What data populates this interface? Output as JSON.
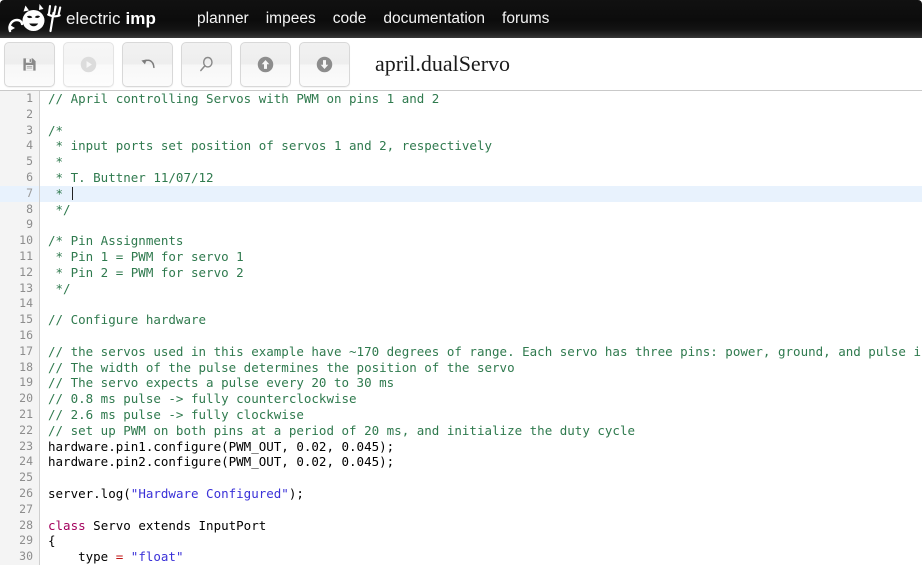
{
  "header": {
    "brand_prefix": "electric ",
    "brand_bold": "imp",
    "logo_icon": "imp-devil-logo-icon",
    "nav": [
      {
        "label": "planner",
        "name": "nav-planner"
      },
      {
        "label": "impees",
        "name": "nav-impees"
      },
      {
        "label": "code",
        "name": "nav-code"
      },
      {
        "label": "documentation",
        "name": "nav-documentation"
      },
      {
        "label": "forums",
        "name": "nav-forums"
      }
    ]
  },
  "toolbar": {
    "document_title": "april.dualServo",
    "buttons": [
      {
        "name": "save-button",
        "icon": "floppy-disk-save-icon",
        "enabled": true
      },
      {
        "name": "run-button",
        "icon": "play-circle-icon",
        "enabled": false
      },
      {
        "name": "undo-button",
        "icon": "undo-arrow-icon",
        "enabled": true
      },
      {
        "name": "search-button",
        "icon": "magnifier-search-icon",
        "enabled": true
      },
      {
        "name": "upload-button",
        "icon": "arrow-up-circle-icon",
        "enabled": true
      },
      {
        "name": "download-button",
        "icon": "arrow-down-circle-icon",
        "enabled": true
      }
    ]
  },
  "editor": {
    "active_line": 7,
    "colors": {
      "comment": "#2f7a4e",
      "string": "#3a31d8",
      "keyword": "#a3005d",
      "operator": "#c01616",
      "active_line_bg": "#e8f2fd",
      "gutter_bg": "#f4f4f4"
    },
    "lines": [
      {
        "n": 1,
        "tokens": [
          {
            "t": "comment",
            "s": "// April controlling Servos with PWM on pins 1 and 2"
          }
        ]
      },
      {
        "n": 2,
        "tokens": []
      },
      {
        "n": 3,
        "tokens": [
          {
            "t": "comment",
            "s": "/*"
          }
        ]
      },
      {
        "n": 4,
        "tokens": [
          {
            "t": "comment",
            "s": " * input ports set position of servos 1 and 2, respectively"
          }
        ]
      },
      {
        "n": 5,
        "tokens": [
          {
            "t": "comment",
            "s": " *"
          }
        ]
      },
      {
        "n": 6,
        "tokens": [
          {
            "t": "comment",
            "s": " * T. Buttner 11/07/12"
          }
        ]
      },
      {
        "n": 7,
        "tokens": [
          {
            "t": "comment",
            "s": " * "
          }
        ],
        "caret": true
      },
      {
        "n": 8,
        "tokens": [
          {
            "t": "comment",
            "s": " */"
          }
        ]
      },
      {
        "n": 9,
        "tokens": []
      },
      {
        "n": 10,
        "tokens": [
          {
            "t": "comment",
            "s": "/* Pin Assignments"
          }
        ]
      },
      {
        "n": 11,
        "tokens": [
          {
            "t": "comment",
            "s": " * Pin 1 = PWM for servo 1"
          }
        ]
      },
      {
        "n": 12,
        "tokens": [
          {
            "t": "comment",
            "s": " * Pin 2 = PWM for servo 2"
          }
        ]
      },
      {
        "n": 13,
        "tokens": [
          {
            "t": "comment",
            "s": " */"
          }
        ]
      },
      {
        "n": 14,
        "tokens": []
      },
      {
        "n": 15,
        "tokens": [
          {
            "t": "comment",
            "s": "// Configure hardware"
          }
        ]
      },
      {
        "n": 16,
        "tokens": []
      },
      {
        "n": 17,
        "tokens": [
          {
            "t": "comment",
            "s": "// the servos used in this example have ~170 degrees of range. Each servo has three pins: power, ground, and pulse in"
          }
        ]
      },
      {
        "n": 18,
        "tokens": [
          {
            "t": "comment",
            "s": "// The width of the pulse determines the position of the servo"
          }
        ]
      },
      {
        "n": 19,
        "tokens": [
          {
            "t": "comment",
            "s": "// The servo expects a pulse every 20 to 30 ms"
          }
        ]
      },
      {
        "n": 20,
        "tokens": [
          {
            "t": "comment",
            "s": "// 0.8 ms pulse -> fully counterclockwise"
          }
        ]
      },
      {
        "n": 21,
        "tokens": [
          {
            "t": "comment",
            "s": "// 2.6 ms pulse -> fully clockwise"
          }
        ]
      },
      {
        "n": 22,
        "tokens": [
          {
            "t": "comment",
            "s": "// set up PWM on both pins at a period of 20 ms, and initialize the duty cycle"
          }
        ]
      },
      {
        "n": 23,
        "tokens": [
          {
            "t": "plain",
            "s": "hardware.pin1.configure(PWM_OUT, 0.02, 0.045);"
          }
        ]
      },
      {
        "n": 24,
        "tokens": [
          {
            "t": "plain",
            "s": "hardware.pin2.configure(PWM_OUT, 0.02, 0.045);"
          }
        ]
      },
      {
        "n": 25,
        "tokens": []
      },
      {
        "n": 26,
        "tokens": [
          {
            "t": "plain",
            "s": "server.log("
          },
          {
            "t": "string",
            "s": "\"Hardware Configured\""
          },
          {
            "t": "plain",
            "s": ");"
          }
        ]
      },
      {
        "n": 27,
        "tokens": []
      },
      {
        "n": 28,
        "tokens": [
          {
            "t": "keyword",
            "s": "class"
          },
          {
            "t": "plain",
            "s": " Servo extends InputPort"
          }
        ]
      },
      {
        "n": 29,
        "tokens": [
          {
            "t": "plain",
            "s": "{"
          }
        ]
      },
      {
        "n": 30,
        "tokens": [
          {
            "t": "plain",
            "s": "    type "
          },
          {
            "t": "op",
            "s": "="
          },
          {
            "t": "plain",
            "s": " "
          },
          {
            "t": "string",
            "s": "\"float\""
          }
        ]
      }
    ]
  }
}
